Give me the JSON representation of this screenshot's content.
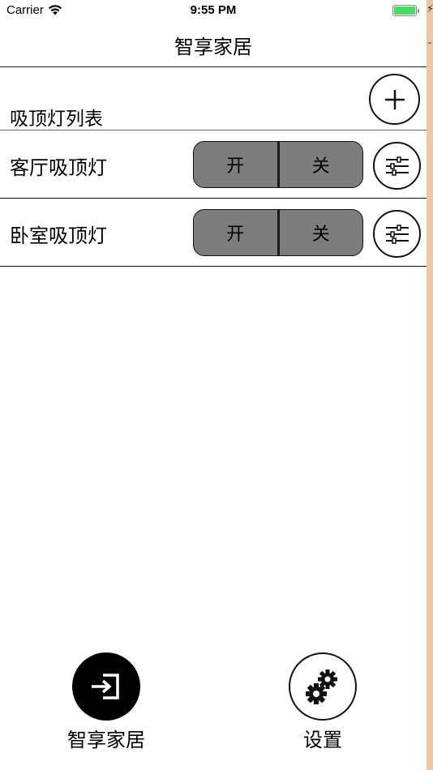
{
  "status_bar": {
    "carrier": "Carrier",
    "time": "9:55 PM",
    "battery_color": "#4cd964"
  },
  "nav": {
    "title": "智享家居"
  },
  "list": {
    "title": "吸顶灯列表",
    "add_icon": "plus-icon"
  },
  "lights": [
    {
      "name": "客厅吸顶灯",
      "on_label": "开",
      "off_label": "关",
      "settings_icon": "sliders-icon"
    },
    {
      "name": "卧室吸顶灯",
      "on_label": "开",
      "off_label": "关",
      "settings_icon": "sliders-icon"
    }
  ],
  "tab_bar": {
    "items": [
      {
        "label": "智享家居",
        "icon": "login-arrow-icon",
        "selected": true
      },
      {
        "label": "设置",
        "icon": "gears-icon",
        "selected": false
      }
    ]
  },
  "colors": {
    "toggle_bg": "#7d7d7d",
    "side_strip": "#ebc7a3"
  }
}
